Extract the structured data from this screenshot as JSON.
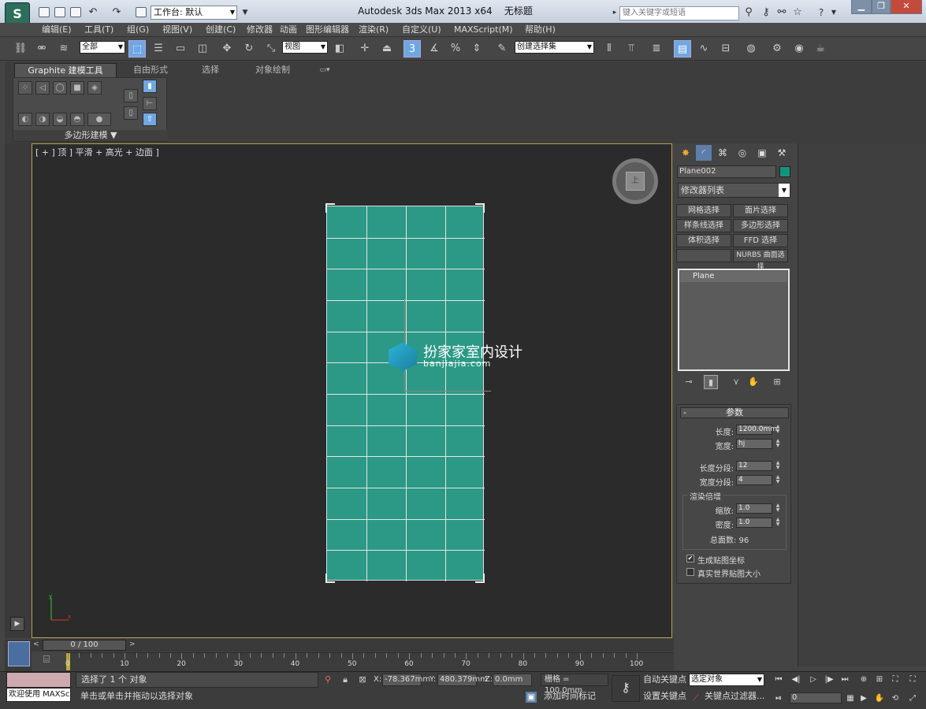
{
  "title_bar": {
    "workspace_label": "工作台: 默认",
    "app_title": "Autodesk 3ds Max  2013 x64",
    "doc_title": "无标题",
    "search_placeholder": "键入关键字或短语"
  },
  "menus": [
    "编辑(E)",
    "工具(T)",
    "组(G)",
    "视图(V)",
    "创建(C)",
    "修改器",
    "动画",
    "图形编辑器",
    "渲染(R)",
    "自定义(U)",
    "MAXScript(M)",
    "帮助(H)"
  ],
  "toolbar": {
    "selection_filter": "全部",
    "coord_system": "视图",
    "snap_label": "3",
    "named_selection": "创建选择集"
  },
  "ribbon": {
    "tabs": [
      "Graphite 建模工具",
      "自由形式",
      "选择",
      "对象绘制"
    ],
    "panel_label": "多边形建模 ▼"
  },
  "viewport": {
    "label": "[ + ] 顶 ] 平滑 + 高光 + 边面 ]",
    "viewcube_face": "上",
    "plane": {
      "length_segments": 12,
      "width_segments": 4,
      "color": "#2b9985"
    },
    "watermark_title": "扮家家室内设计",
    "watermark_url": "banjiajia.com"
  },
  "command_panel": {
    "object_name": "Plane002",
    "object_color": "#17937d",
    "modifier_list": "修改器列表",
    "modifier_buttons": [
      "网格选择",
      "面片选择",
      "样条线选择",
      "多边形选择",
      "体积选择",
      "FFD 选择",
      "",
      "NURBS 曲面选择"
    ],
    "stack_item": "Plane",
    "params": {
      "header": "参数",
      "length_label": "长度:",
      "length_value": "1200.0mm",
      "width_label": "宽度:",
      "width_value": "hj",
      "length_seg_label": "长度分段:",
      "length_seg_value": "12",
      "width_seg_label": "宽度分段:",
      "width_seg_value": "4",
      "render_group_label": "渲染倍增",
      "scale_label": "缩放:",
      "scale_value": "1.0",
      "density_label": "密度:",
      "density_value": "1.0",
      "total_faces": "总面数: 96",
      "gen_map_coords": "生成贴图坐标",
      "real_world_map": "真实世界贴图大小"
    }
  },
  "timeline": {
    "slider_label": "0 / 100",
    "ticks": [
      "0",
      "10",
      "20",
      "30",
      "40",
      "50",
      "60",
      "70",
      "80",
      "90",
      "100"
    ]
  },
  "status": {
    "maxscript_label": "欢迎使用 MAXSc",
    "line1": "选择了 1 个 对象",
    "line2": "单击或单击并拖动以选择对象",
    "x_label": "X:",
    "x_value": "-78.367mm",
    "y_label": "Y:",
    "y_value": "480.379mm",
    "z_label": "Z:",
    "z_value": "0.0mm",
    "grid": "栅格 = 100.0mm",
    "add_time_tag": "添加时间标记",
    "auto_key": "自动关键点",
    "set_key": "设置关键点",
    "selected_object": "选定对象",
    "key_filters": "关键点过滤器...",
    "frame_value": "0"
  }
}
